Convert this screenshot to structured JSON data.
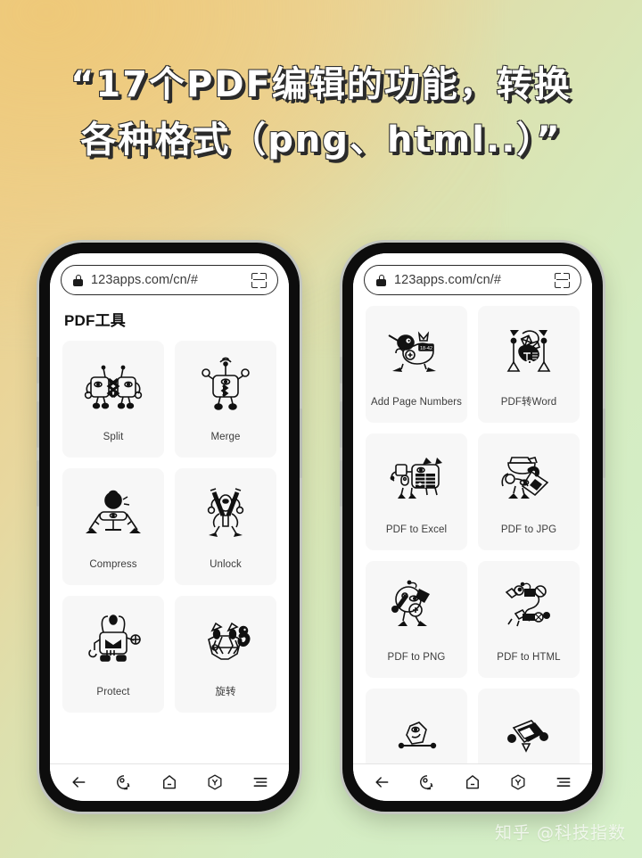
{
  "headline": {
    "line1": "“17个PDF编辑的功能，转换",
    "line2": "各种格式（png、html..）”"
  },
  "colors": {
    "bg_start": "#edcd85",
    "bg_end": "#d6efc9",
    "card_bg": "#f7f7f7",
    "text": "#3c3c3c",
    "phone_frame": "#0d0d0d"
  },
  "watermark": "知乎 @科技指数",
  "browser": {
    "url": "123apps.com/cn/#",
    "lock_icon": "lock-icon",
    "scan_icon": "scan-frame-icon"
  },
  "nav": {
    "items": [
      {
        "icon": "back-arrow-icon",
        "label": "返回"
      },
      {
        "icon": "tabs-count-icon",
        "label": "标签页"
      },
      {
        "icon": "home-icon",
        "label": "主页"
      },
      {
        "icon": "hexagon-y-icon",
        "label": "工具"
      },
      {
        "icon": "menu-lines-icon",
        "label": "菜单"
      }
    ]
  },
  "phone_left": {
    "page_title": "PDF工具",
    "cards": [
      {
        "label": "Split",
        "icon": "split-robot-icon"
      },
      {
        "label": "Merge",
        "icon": "merge-robot-icon"
      },
      {
        "label": "Compress",
        "icon": "compress-robot-icon"
      },
      {
        "label": "Unlock",
        "icon": "unlock-robot-icon"
      },
      {
        "label": "Protect",
        "icon": "protect-robot-icon"
      },
      {
        "label": "旋转",
        "icon": "rotate-robot-icon"
      }
    ]
  },
  "phone_right": {
    "cards": [
      {
        "label": "Add Page Numbers",
        "icon": "page-numbers-robot-icon"
      },
      {
        "label": "PDF转Word",
        "icon": "pdf-to-word-robot-icon"
      },
      {
        "label": "PDF to Excel",
        "icon": "pdf-to-excel-robot-icon"
      },
      {
        "label": "PDF to JPG",
        "icon": "pdf-to-jpg-robot-icon"
      },
      {
        "label": "PDF to PNG",
        "icon": "pdf-to-png-robot-icon"
      },
      {
        "label": "PDF to HTML",
        "icon": "pdf-to-html-robot-icon"
      },
      {
        "label": "",
        "icon": "partial-robot-icon-a"
      },
      {
        "label": "",
        "icon": "partial-robot-icon-b"
      }
    ]
  }
}
